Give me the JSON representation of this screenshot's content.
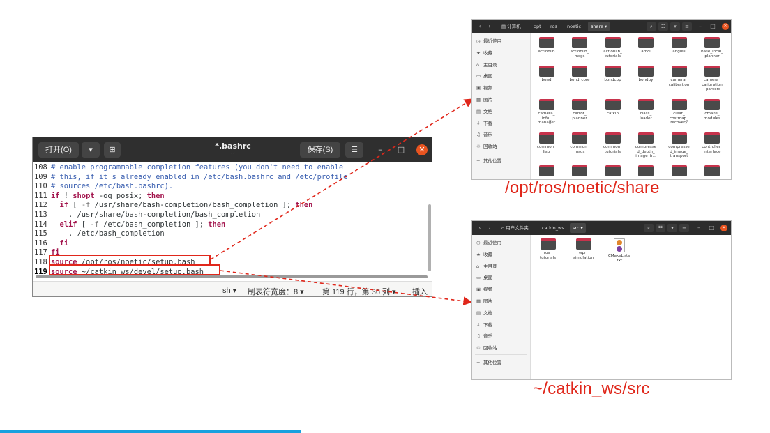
{
  "editor": {
    "open_label": "打开(O)",
    "title": "*.bashrc",
    "title_sub": "~",
    "save_label": "保存(S)",
    "menu_icon": "hamburger-icon",
    "lines": [
      {
        "n": "108",
        "parts": [
          {
            "t": "# enable programmable completion features (you don't need to enable",
            "c": "cm"
          }
        ]
      },
      {
        "n": "109",
        "parts": [
          {
            "t": "# this, if it's already enabled in /etc/bash.bashrc and /etc/profile",
            "c": "cm"
          }
        ]
      },
      {
        "n": "110",
        "parts": [
          {
            "t": "# sources /etc/bash.bashrc).",
            "c": "cm"
          }
        ]
      },
      {
        "n": "111",
        "parts": [
          {
            "t": "if",
            "c": "kw"
          },
          {
            "t": " ! ",
            "c": ""
          },
          {
            "t": "shopt",
            "c": "kw"
          },
          {
            "t": " -oq posix; ",
            "c": ""
          },
          {
            "t": "then",
            "c": "kw"
          }
        ]
      },
      {
        "n": "112",
        "parts": [
          {
            "t": "  ",
            "c": ""
          },
          {
            "t": "if",
            "c": "kw"
          },
          {
            "t": " [ ",
            "c": ""
          },
          {
            "t": "-f",
            "c": "opt"
          },
          {
            "t": " /usr/share/bash-completion/bash_completion ]; ",
            "c": ""
          },
          {
            "t": "then",
            "c": "kw"
          }
        ]
      },
      {
        "n": "113",
        "parts": [
          {
            "t": "    . /usr/share/bash-completion/bash_completion",
            "c": ""
          }
        ]
      },
      {
        "n": "114",
        "parts": [
          {
            "t": "  ",
            "c": ""
          },
          {
            "t": "elif",
            "c": "kw"
          },
          {
            "t": " [ ",
            "c": ""
          },
          {
            "t": "-f",
            "c": "opt"
          },
          {
            "t": " /etc/bash_completion ]; ",
            "c": ""
          },
          {
            "t": "then",
            "c": "kw"
          }
        ]
      },
      {
        "n": "115",
        "parts": [
          {
            "t": "    . /etc/bash_completion",
            "c": ""
          }
        ]
      },
      {
        "n": "116",
        "parts": [
          {
            "t": "  ",
            "c": ""
          },
          {
            "t": "fi",
            "c": "kw"
          }
        ]
      },
      {
        "n": "117",
        "parts": [
          {
            "t": "fi",
            "c": "kw"
          }
        ]
      },
      {
        "n": "118",
        "parts": [
          {
            "t": "source",
            "c": "kw"
          },
          {
            "t": " /opt/ros/noetic/setup.bash",
            "c": ""
          }
        ]
      },
      {
        "n": "119",
        "cur": true,
        "parts": [
          {
            "t": "source",
            "c": "kw"
          },
          {
            "t": " ~/catkin_ws/devel/setup.bash",
            "c": ""
          }
        ]
      }
    ],
    "status": {
      "lang": "sh ▾",
      "tab_width": "制表符宽度：8 ▾",
      "position": "第 119 行，第 36 列 ▾",
      "mode": "插入"
    }
  },
  "label_top": "/opt/ros/noetic/share",
  "label_bottom": "~/catkin_ws/src",
  "fm_top": {
    "crumbs": [
      "计算机",
      "opt",
      "ros",
      "noetic",
      "share ▾"
    ],
    "sidebar": [
      {
        "icon": "clock-icon",
        "label": "最近使用"
      },
      {
        "icon": "star-icon",
        "label": "收藏"
      },
      {
        "icon": "home-icon",
        "label": "主目录"
      },
      {
        "icon": "desktop-icon",
        "label": "桌面"
      },
      {
        "icon": "video-icon",
        "label": "视频"
      },
      {
        "icon": "picture-icon",
        "label": "图片"
      },
      {
        "icon": "document-icon",
        "label": "文档"
      },
      {
        "icon": "download-icon",
        "label": "下载"
      },
      {
        "icon": "music-icon",
        "label": "音乐"
      },
      {
        "icon": "trash-icon",
        "label": "回收站"
      },
      {
        "icon": "plus-icon",
        "label": "其他位置"
      }
    ],
    "items": [
      "actionlib",
      "actionlib_\nmsgs",
      "actionlib_\ntutorials",
      "amcl",
      "angles",
      "base_local_\nplanner",
      "bond",
      "bond_core",
      "bondcpp",
      "bondpy",
      "camera_\ncalibration",
      "camera_\ncalibration\n_parsers",
      "camera_\ninfo_\nmanager",
      "carrot_\nplanner",
      "catkin",
      "class_\nloader",
      "clear_\ncostmap_\nrecovery",
      "cmake_\nmodules",
      "common_\nlisp",
      "common_\nmsgs",
      "common_\ntutorials",
      "compresse\nd_depth_\nimage_tr...",
      "compresse\nd_image_\ntransport",
      "controller_\ninterface",
      "",
      "",
      "",
      "",
      "",
      ""
    ]
  },
  "fm_bottom": {
    "crumbs": [
      "用户文件夹",
      "catkin_ws",
      "src ▾"
    ],
    "sidebar": [
      {
        "icon": "clock-icon",
        "label": "最近使用"
      },
      {
        "icon": "star-icon",
        "label": "收藏"
      },
      {
        "icon": "home-icon",
        "label": "主目录"
      },
      {
        "icon": "desktop-icon",
        "label": "桌面"
      },
      {
        "icon": "video-icon",
        "label": "视频"
      },
      {
        "icon": "picture-icon",
        "label": "图片"
      },
      {
        "icon": "document-icon",
        "label": "文档"
      },
      {
        "icon": "download-icon",
        "label": "下载"
      },
      {
        "icon": "music-icon",
        "label": "音乐"
      },
      {
        "icon": "trash-icon",
        "label": "回收站"
      },
      {
        "icon": "plus-icon",
        "label": "其他位置"
      }
    ],
    "items": [
      {
        "label": "ros_\ntutorials",
        "kind": "folder"
      },
      {
        "label": "wpr_\nsimulation",
        "kind": "folder"
      },
      {
        "label": "CMakeLists\n.txt",
        "kind": "file"
      }
    ]
  },
  "colors": {
    "accent_red": "#e0271b",
    "ubuntu_orange": "#e95420",
    "folder_red": "#c7334c",
    "bottom_bar": "#18a1df"
  }
}
